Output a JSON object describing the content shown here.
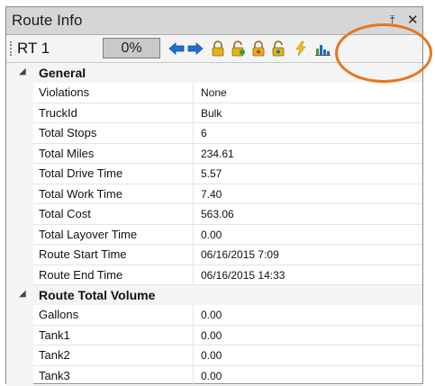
{
  "window": {
    "title": "Route Info",
    "pin_glyph": "⤒",
    "close_glyph": "✕"
  },
  "toolbar": {
    "route_label": "RT 1",
    "progress_text": "0%",
    "progress": 0,
    "icons": [
      "arrow-left-icon",
      "arrow-right-icon",
      "lock-icon",
      "unlock-icon",
      "lock-refresh-icon",
      "unlock-refresh-icon",
      "lightning-icon",
      "bar-chart-icon"
    ],
    "colors": {
      "arrow": "#1f6fd6",
      "lock": "#e0b21b",
      "chart": "#1f66c9",
      "chart_green": "#3a9d33",
      "highlight": "#e8751a"
    }
  },
  "grid": {
    "categories": [
      {
        "label": "General",
        "rows": [
          {
            "key": "Violations",
            "value": "None"
          },
          {
            "key": "TruckId",
            "value": "Bulk"
          },
          {
            "key": "Total Stops",
            "value": "6"
          },
          {
            "key": "Total Miles",
            "value": "234.61"
          },
          {
            "key": "Total Drive Time",
            "value": "5.57"
          },
          {
            "key": "Total Work Time",
            "value": "7.40"
          },
          {
            "key": "Total Cost",
            "value": "563.06"
          },
          {
            "key": "Total Layover Time",
            "value": "0.00"
          },
          {
            "key": "Route Start Time",
            "value": "06/16/2015 7:09"
          },
          {
            "key": "Route End Time",
            "value": "06/16/2015 14:33"
          }
        ]
      },
      {
        "label": "Route Total Volume",
        "rows": [
          {
            "key": "Gallons",
            "value": "0.00"
          },
          {
            "key": "Tank1",
            "value": "0.00"
          },
          {
            "key": "Tank2",
            "value": "0.00"
          },
          {
            "key": "Tank3",
            "value": "0.00"
          }
        ]
      }
    ]
  }
}
